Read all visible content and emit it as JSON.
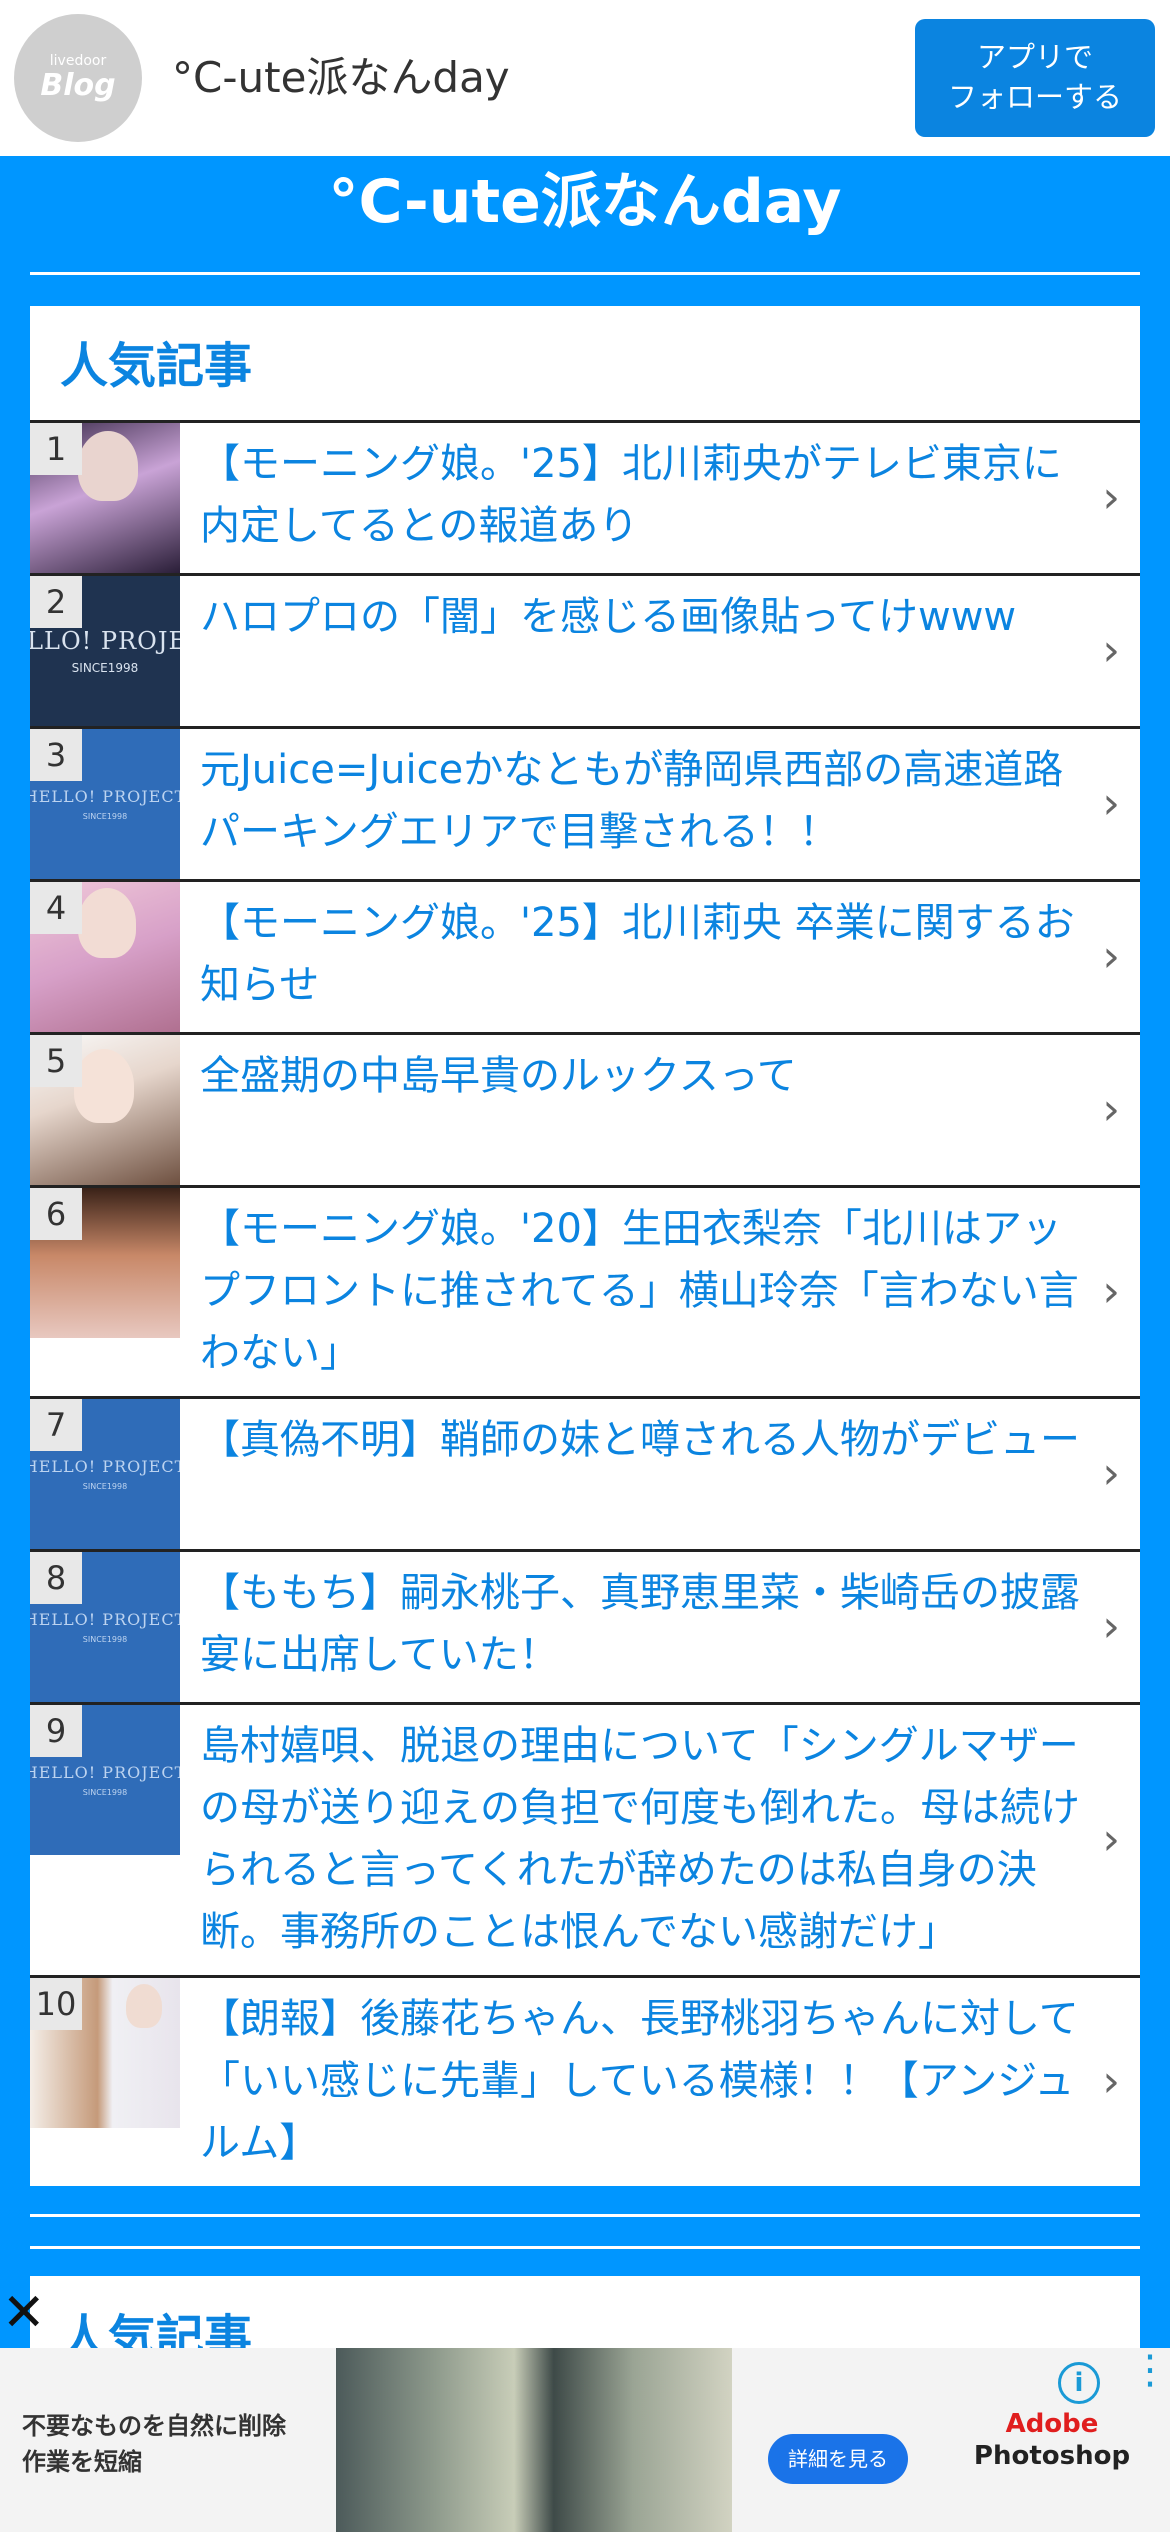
{
  "topbar": {
    "logo_small": "livedoor",
    "logo_big": "Blog",
    "title": "°C-ute派なんday",
    "follow_line1": "アプリで",
    "follow_line2": "フォローする"
  },
  "blog_title": "°C-ute派なんday",
  "popular": {
    "heading": "人気記事",
    "items": [
      {
        "rank": "1",
        "title": "【モーニング娘。'25】北川莉央がテレビ東京に内定してるとの報道あり"
      },
      {
        "rank": "2",
        "title": "ハロプロの「闇」を感じる画像貼ってけwww"
      },
      {
        "rank": "3",
        "title": "元Juice=Juiceかなともが静岡県西部の高速道路パーキングエリアで目撃される！！"
      },
      {
        "rank": "4",
        "title": "【モーニング娘。'25】北川莉央 卒業に関するお知らせ"
      },
      {
        "rank": "5",
        "title": "全盛期の中島早貴のルックスって"
      },
      {
        "rank": "6",
        "title": "【モーニング娘。'20】生田衣梨奈「北川はアップフロントに推されてる」横山玲奈「言わない言わない」"
      },
      {
        "rank": "7",
        "title": "【真偽不明】鞘師の妹と噂される人物がデビュー"
      },
      {
        "rank": "8",
        "title": "【ももち】嗣永桃子、真野恵里菜・柴崎岳の披露宴に出席していた！"
      },
      {
        "rank": "9",
        "title": "島村嬉唄、脱退の理由について「シングルマザーの母が送り迎えの負担で何度も倒れた。母は続けられると言ってくれたが辞めたのは私自身の決断。事務所のことは恨んでない感謝だけ」"
      },
      {
        "rank": "10",
        "title": "【朗報】後藤花ちゃん、長野桃羽ちゃんに対して「いい感じに先輩」している模様！！【アンジュルム】"
      }
    ],
    "thumb_text_dark": "HELLO! PROJECT",
    "thumb_text_dark_sub": "SINCE1998",
    "thumb_text": "HELLO! PROJECT",
    "thumb_text_sub": "SINCE1998"
  },
  "popular2": {
    "heading": "人気記事"
  },
  "ad": {
    "close": "✕",
    "text_line1": "不要なものを自然に削除",
    "text_line2": "作業を短縮",
    "cta": "詳細を見る",
    "brand_line1": "Adobe",
    "brand_line2": "Photoshop",
    "info": "i",
    "more": "⋮"
  },
  "colors": {
    "accent": "#0096ff",
    "link": "#0b84e0",
    "button": "#0b84e0"
  }
}
